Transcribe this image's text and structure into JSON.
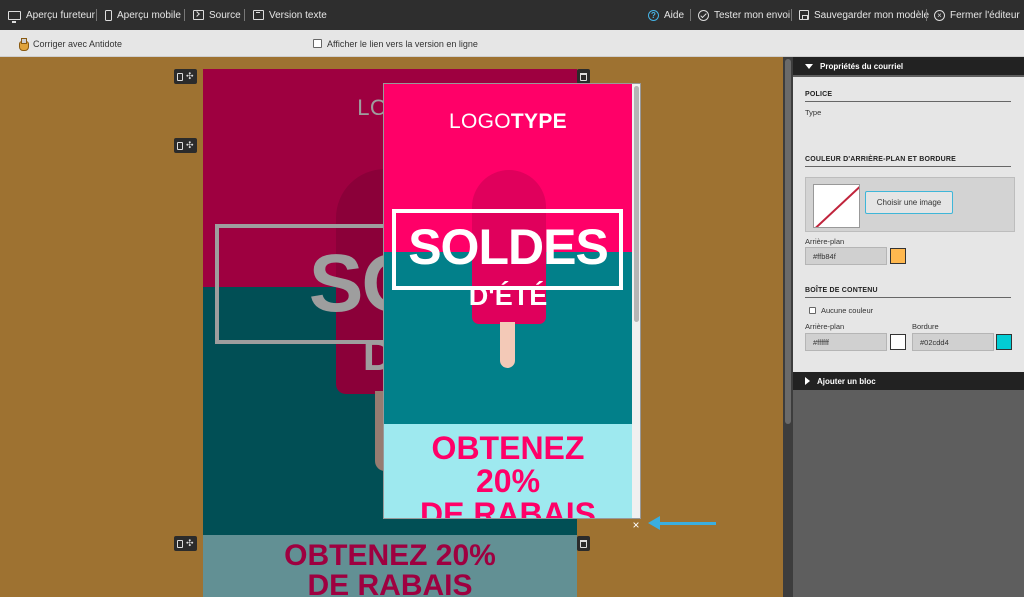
{
  "toolbar": {
    "preview_browser": "Aperçu fureteur",
    "preview_mobile": "Aperçu mobile",
    "source": "Source",
    "text_version": "Version texte",
    "help": "Aide",
    "test_send": "Tester mon envoi",
    "save_template": "Sauvegarder mon modèle",
    "close_editor": "Fermer l'éditeur"
  },
  "subbar": {
    "antidote": "Corriger avec Antidote",
    "show_online_link": "Afficher le lien vers la version en ligne",
    "show_online_link_checked": false
  },
  "email": {
    "logo": "LOGO",
    "headline": "SOL",
    "headline2": "D'I",
    "promo_line1": "OBTENEZ 20%",
    "promo_line2": "DE RABAIS"
  },
  "preview": {
    "logo_light": "LOGO",
    "logo_bold": "TYPE",
    "headline": "SOLDES",
    "subheadline": "D'ÉTÉ",
    "promo_line1": "OBTENEZ",
    "promo_line2": "20%",
    "promo_line3": "DE RABAIS",
    "close": "×"
  },
  "panel": {
    "email_properties": "Propriétés du courriel",
    "font_section": "POLICE",
    "font_type_label": "Type",
    "bg_section": "COULEUR D'ARRIÈRE-PLAN ET BORDURE",
    "choose_image": "Choisir une image",
    "bg_label": "Arrière-plan",
    "bg_value": "#ffb84f",
    "content_box_section": "BOÎTE DE CONTENU",
    "no_color": "Aucune couleur",
    "no_color_checked": false,
    "content_bg_label": "Arrière-plan",
    "content_bg_value": "#ffffff",
    "border_label": "Bordure",
    "border_value": "#02cdd4",
    "add_block": "Ajouter un bloc"
  },
  "colors": {
    "page_bg": "#ffb84f",
    "brand_pink": "#ff0068",
    "teal": "#02808a",
    "light_cyan": "#9ee9ef",
    "accent_blue": "#3aaee0",
    "border_swatch": "#02cdd4"
  }
}
